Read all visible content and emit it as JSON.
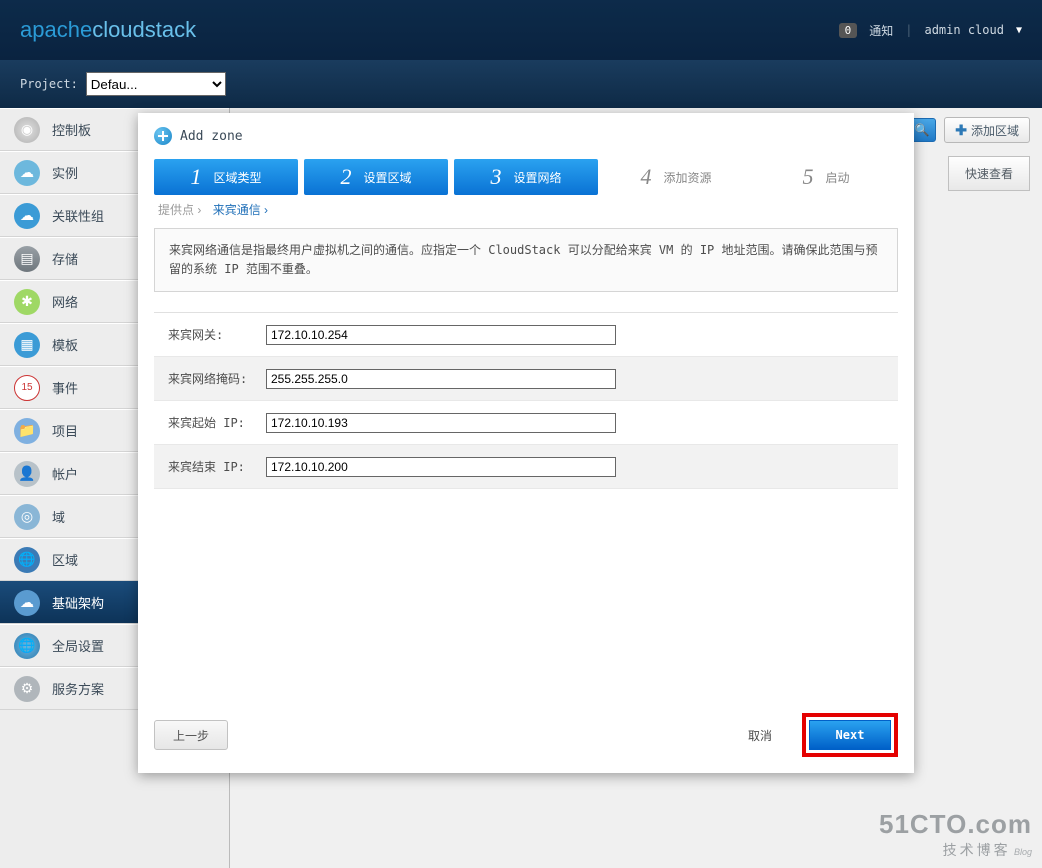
{
  "header": {
    "logo_left": "apache",
    "logo_right": "cloudstack",
    "notif_count": "0",
    "notif_label": "通知",
    "user": "admin cloud"
  },
  "projectbar": {
    "label": "Project:",
    "selected": "Defau..."
  },
  "sidebar": [
    {
      "key": "dashboard",
      "label": "控制板"
    },
    {
      "key": "instances",
      "label": "实例"
    },
    {
      "key": "affinity",
      "label": "关联性组"
    },
    {
      "key": "storage",
      "label": "存储"
    },
    {
      "key": "network",
      "label": "网络"
    },
    {
      "key": "templates",
      "label": "模板"
    },
    {
      "key": "events",
      "label": "事件"
    },
    {
      "key": "projects",
      "label": "项目"
    },
    {
      "key": "accounts",
      "label": "帐户"
    },
    {
      "key": "domains",
      "label": "域"
    },
    {
      "key": "regions",
      "label": "区域"
    },
    {
      "key": "infrastructure",
      "label": "基础架构",
      "active": true
    },
    {
      "key": "global",
      "label": "全局设置"
    },
    {
      "key": "service",
      "label": "服务方案"
    }
  ],
  "toolbar": {
    "add_zone": "添加区域",
    "quickview": "快速查看"
  },
  "modal": {
    "title": "Add zone",
    "steps": [
      {
        "num": "1",
        "label": "区域类型",
        "active": true
      },
      {
        "num": "2",
        "label": "设置区域",
        "active": true
      },
      {
        "num": "3",
        "label": "设置网络",
        "active": true
      },
      {
        "num": "4",
        "label": "添加资源",
        "active": false
      },
      {
        "num": "5",
        "label": "启动",
        "active": false
      }
    ],
    "breadcrumb_root": "提供点",
    "breadcrumb_cur": "来宾通信",
    "desc": "来宾网络通信是指最终用户虚拟机之间的通信。应指定一个 CloudStack 可以分配给来宾 VM 的 IP 地址范围。请确保此范围与预留的系统 IP 范围不重叠。",
    "fields": [
      {
        "label": "来宾网关:",
        "value": "172.10.10.254"
      },
      {
        "label": "来宾网络掩码:",
        "value": "255.255.255.0"
      },
      {
        "label": "来宾起始 IP:",
        "value": "172.10.10.193"
      },
      {
        "label": "来宾结束 IP:",
        "value": "172.10.10.200"
      }
    ],
    "prev": "上一步",
    "cancel": "取消",
    "next": "Next"
  },
  "watermark": {
    "line1": "51CTO.com",
    "line2": "技术博客",
    "blog": "Blog"
  }
}
